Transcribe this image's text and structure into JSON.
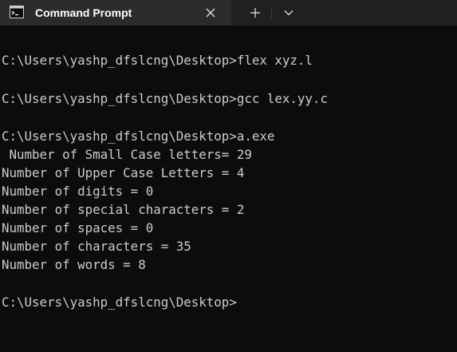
{
  "window": {
    "tab_title": "Command Prompt"
  },
  "icons": {
    "tab_icon": "terminal-icon",
    "close": "close-icon",
    "new_tab": "plus-icon",
    "dropdown": "chevron-down-icon"
  },
  "terminal": {
    "lines": [
      "C:\\Users\\yashp_dfslcng\\Desktop>flex xyz.l",
      "C:\\Users\\yashp_dfslcng\\Desktop>gcc lex.yy.c",
      "C:\\Users\\yashp_dfslcng\\Desktop>a.exe",
      " Number of Small Case letters= 29",
      "Number of Upper Case Letters = 4",
      "Number of digits = 0",
      "Number of special characters = 2",
      "Number of spaces = 0",
      "Number of characters = 35",
      "Number of words = 8",
      "C:\\Users\\yashp_dfslcng\\Desktop>"
    ]
  },
  "colors": {
    "background": "#0c0c0c",
    "tab_active": "#2b2b2b",
    "tabbar": "#202020",
    "text": "#cccccc"
  }
}
